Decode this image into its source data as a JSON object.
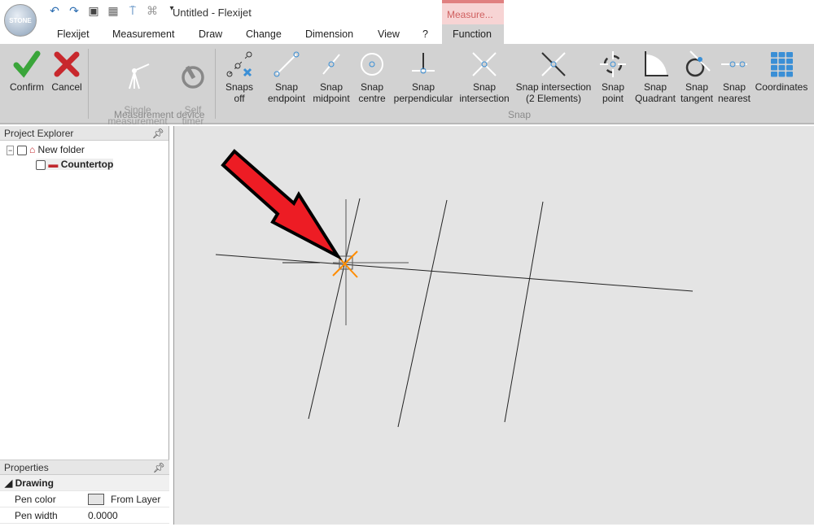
{
  "app": {
    "title": "Untitled -  Flexijet",
    "logo_text": "STONE",
    "context_tab": "Measure..."
  },
  "quick_access": [
    {
      "icon": "undo-icon"
    },
    {
      "icon": "redo-icon"
    },
    {
      "icon": "save-icon"
    },
    {
      "icon": "calculator-icon"
    },
    {
      "icon": "device-icon"
    },
    {
      "icon": "gamepad-icon"
    },
    {
      "icon": "customize-icon"
    }
  ],
  "tabs": [
    "Flexijet",
    "Measurement",
    "Draw",
    "Change",
    "Dimension",
    "View",
    "?",
    "Function"
  ],
  "active_tab": "Function",
  "ribbon": {
    "confirm": "Confirm",
    "cancel": "Cancel",
    "single_measurement": "Single\nmeasurement",
    "self_timer": "Self\ntimer",
    "group_measurement_device": "Measurement device",
    "snaps": [
      {
        "label": "Snaps\noff",
        "icon": "snaps-off-icon"
      },
      {
        "label": "Snap\nendpoint",
        "icon": "snap-endpoint-icon"
      },
      {
        "label": "Snap\nmidpoint",
        "icon": "snap-midpoint-icon"
      },
      {
        "label": "Snap\ncentre",
        "icon": "snap-centre-icon"
      },
      {
        "label": "Snap\nperpendicular",
        "icon": "snap-perpendicular-icon"
      },
      {
        "label": "Snap\nintersection",
        "icon": "snap-intersection-icon"
      },
      {
        "label": "Snap intersection\n(2 Elements)",
        "icon": "snap-intersection-2-icon"
      },
      {
        "label": "Snap\npoint",
        "icon": "snap-point-icon"
      },
      {
        "label": "Snap\nQuadrant",
        "icon": "snap-quadrant-icon"
      },
      {
        "label": "Snap\ntangent",
        "icon": "snap-tangent-icon"
      },
      {
        "label": "Snap\nnearest",
        "icon": "snap-nearest-icon"
      },
      {
        "label": "Coordinates",
        "icon": "coordinates-icon"
      }
    ],
    "group_snap": "Snap"
  },
  "project_explorer": {
    "title": "Project Explorer",
    "folder": "New folder",
    "item": "Countertop"
  },
  "properties": {
    "title": "Properties",
    "section": "Drawing",
    "rows": [
      {
        "name": "Pen color",
        "value": "From Layer"
      },
      {
        "name": "Pen width",
        "value": "0.0000"
      }
    ]
  },
  "colors": {
    "arrow": "#ed1c24",
    "snap_marker": "#ff8c00",
    "accent": "#3a8fd6"
  }
}
